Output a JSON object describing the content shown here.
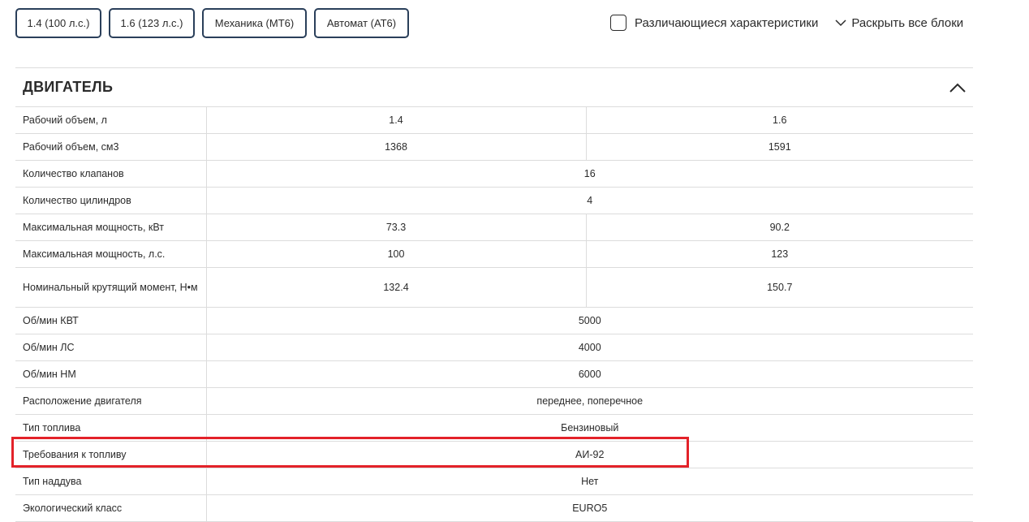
{
  "filters": [
    "1.4 (100 л.с.)",
    "1.6 (123 л.с.)",
    "Механика (МТ6)",
    "Автомат (АТ6)"
  ],
  "options": {
    "diff_label": "Различающиеся характеристики",
    "expand_label": "Раскрыть все блоки"
  },
  "section": {
    "title": "ДВИГАТЕЛЬ",
    "rows": [
      {
        "label": "Рабочий объем, л",
        "values": [
          "1.4",
          "1.6"
        ]
      },
      {
        "label": "Рабочий объем, см3",
        "values": [
          "1368",
          "1591"
        ]
      },
      {
        "label": "Количество клапанов",
        "values": [
          "16"
        ]
      },
      {
        "label": "Количество цилиндров",
        "values": [
          "4"
        ]
      },
      {
        "label": "Максимальная мощность, кВт",
        "values": [
          "73.3",
          "90.2"
        ]
      },
      {
        "label": "Максимальная мощность, л.с.",
        "values": [
          "100",
          "123"
        ]
      },
      {
        "label": "Номинальный крутящий момент, Н•м",
        "values": [
          "132.4",
          "150.7"
        ]
      },
      {
        "label": "Об/мин КВТ",
        "values": [
          "5000"
        ]
      },
      {
        "label": "Об/мин ЛС",
        "values": [
          "4000"
        ]
      },
      {
        "label": "Об/мин НМ",
        "values": [
          "6000"
        ]
      },
      {
        "label": "Расположение двигателя",
        "values": [
          "переднее, поперечное"
        ]
      },
      {
        "label": "Тип топлива",
        "values": [
          "Бензиновый"
        ]
      },
      {
        "label": "Требования к топливу",
        "values": [
          "АИ-92"
        ]
      },
      {
        "label": "Тип наддува",
        "values": [
          "Нет"
        ]
      },
      {
        "label": "Экологический класс",
        "values": [
          "EURO5"
        ]
      }
    ]
  },
  "colors": {
    "chip_border": "#2a3f5a",
    "highlight": "#e32229",
    "divider": "#dcdcdc"
  }
}
